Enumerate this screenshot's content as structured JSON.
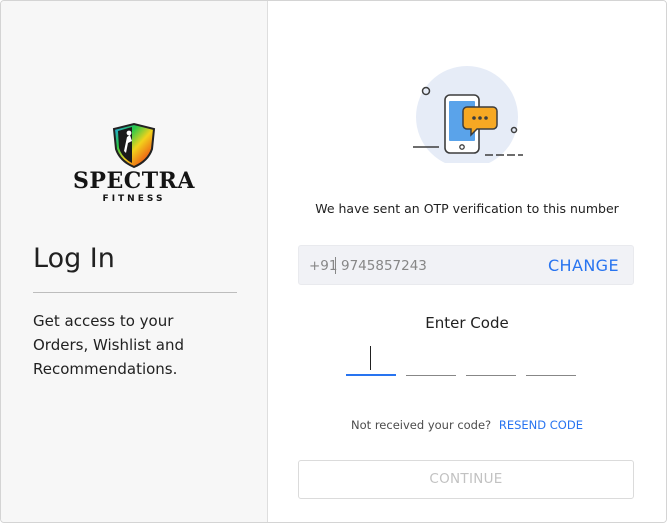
{
  "brand": {
    "name": "SPECTRA",
    "tagline": "FITNESS",
    "logo_icon": "spectra-shield-logo"
  },
  "login": {
    "title": "Log In",
    "description": "Get access to your Orders, Wishlist and Recommendations."
  },
  "otp": {
    "illustration_icon": "phone-chat-icon",
    "message": "We have sent an OTP verification to this number",
    "country_code": "+91",
    "phone_number": "9745857243",
    "change_label": "CHANGE",
    "enter_code_label": "Enter Code",
    "code_digits": [
      "",
      "",
      "",
      ""
    ],
    "not_received_text": "Not received your code?",
    "resend_label": "RESEND CODE",
    "continue_label": "CONTINUE"
  },
  "colors": {
    "accent": "#2874f0",
    "left_panel_bg": "#f7f7f7",
    "input_bg": "#f1f2f6",
    "disabled_text": "#c2c2c2"
  }
}
